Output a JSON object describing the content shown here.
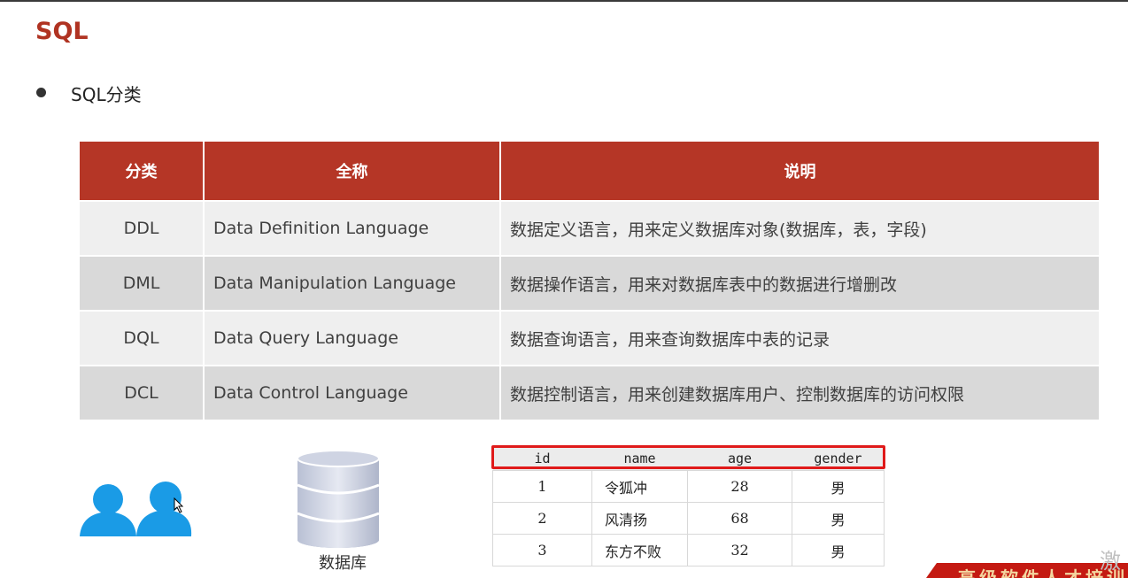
{
  "title": "SQL",
  "bullet": "SQL分类",
  "table": {
    "headers": [
      "分类",
      "全称",
      "说明"
    ],
    "rows": [
      {
        "code": "DDL",
        "name": "Data Definition Language",
        "desc": "数据定义语言，用来定义数据库对象(数据库，表，字段)"
      },
      {
        "code": "DML",
        "name": "Data Manipulation Language",
        "desc": "数据操作语言，用来对数据库表中的数据进行增删改"
      },
      {
        "code": "DQL",
        "name": "Data Query Language",
        "desc": "数据查询语言，用来查询数据库中表的记录"
      },
      {
        "code": "DCL",
        "name": "Data Control Language",
        "desc": "数据控制语言，用来创建数据库用户、控制数据库的访问权限"
      }
    ]
  },
  "database_label": "数据库",
  "data_table": {
    "columns": [
      "id",
      "name",
      "age",
      "gender"
    ],
    "rows": [
      {
        "id": "1",
        "name": "令狐冲",
        "age": "28",
        "gender": "男"
      },
      {
        "id": "2",
        "name": "风清扬",
        "age": "68",
        "gender": "男"
      },
      {
        "id": "3",
        "name": "东方不败",
        "age": "32",
        "gender": "男"
      }
    ]
  },
  "banner_text": "高级软件人才培训",
  "watermark": "激",
  "colors": {
    "accent": "#b53626",
    "title": "#b03322",
    "user_icon": "#1a9be6",
    "highlight": "#e01a1a"
  }
}
